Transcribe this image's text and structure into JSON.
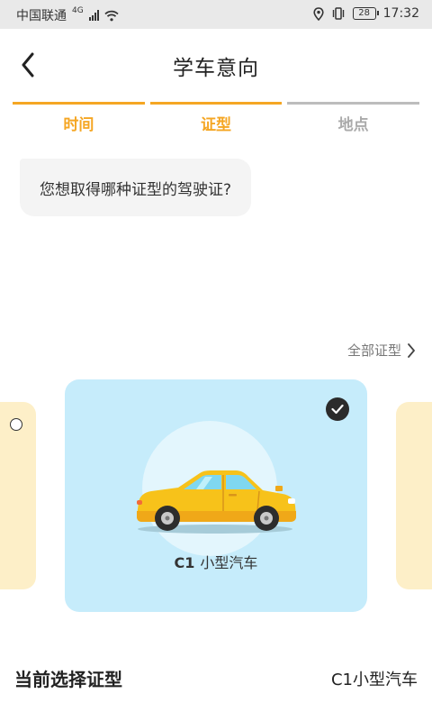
{
  "status_bar": {
    "carrier": "中国联通",
    "network": "4G",
    "battery": "28",
    "time": "17:32"
  },
  "header": {
    "title": "学车意向"
  },
  "tabs": [
    {
      "label": "时间",
      "active": true
    },
    {
      "label": "证型",
      "active": true
    },
    {
      "label": "地点",
      "active": false
    }
  ],
  "question": "您想取得哪种证型的驾驶证?",
  "all_types_link": "全部证型",
  "carousel": {
    "selected_card": {
      "code": "C1",
      "name": "小型汽车",
      "selected": true,
      "icon": "car-icon"
    }
  },
  "summary": {
    "label": "当前选择证型",
    "value": "C1小型汽车"
  },
  "colors": {
    "accent": "#f5a623",
    "card_bg": "#c6ecfb",
    "side_card_bg": "#fdefc8"
  }
}
